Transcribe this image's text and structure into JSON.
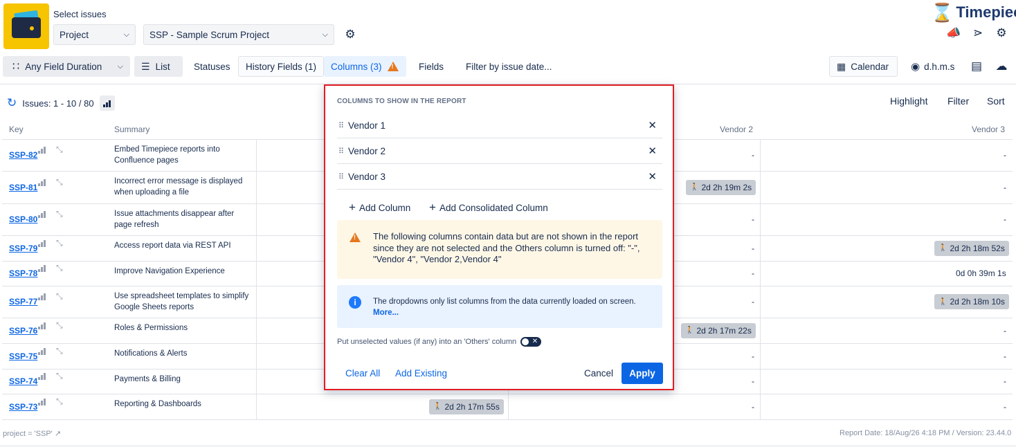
{
  "header": {
    "select_label": "Select issues",
    "scope_select": "Project",
    "project_select": "SSP - Sample Scrum Project",
    "brand": "Timepiece"
  },
  "toolbar": {
    "duration_select": "Any Field Duration",
    "list": "List",
    "statuses": "Statuses",
    "history_fields": "History Fields (1)",
    "columns": "Columns (3)",
    "fields": "Fields",
    "filter_date": "Filter by issue date...",
    "calendar": "Calendar",
    "time_format": "d.h.m.s"
  },
  "issues_bar": {
    "count": "Issues: 1 - 10 / 80",
    "highlight": "Highlight",
    "filter": "Filter",
    "sort": "Sort"
  },
  "table": {
    "headers": {
      "key": "Key",
      "summary": "Summary",
      "vendor2": "Vendor 2",
      "vendor3": "Vendor 3"
    },
    "rows": [
      {
        "key": "SSP-82",
        "summary": "Embed Timepiece reports into Confluence pages",
        "v1": "",
        "v2": "-",
        "v3": "-"
      },
      {
        "key": "SSP-81",
        "summary": "Incorrect error message is displayed when uploading a file",
        "v1": "",
        "v2": "2d 2h 19m 2s",
        "v3": "-"
      },
      {
        "key": "SSP-80",
        "summary": "Issue attachments disappear after page refresh",
        "v1": "",
        "v2": "-",
        "v3": "-"
      },
      {
        "key": "SSP-79",
        "summary": "Access report data via REST API",
        "v1": "",
        "v2": "-",
        "v3": "2d 2h 18m 52s"
      },
      {
        "key": "SSP-78",
        "summary": "Improve Navigation Experience",
        "v1": "",
        "v2": "-",
        "v3": "0d 0h 39m 1s"
      },
      {
        "key": "SSP-77",
        "summary": "Use spreadsheet templates to simplify Google Sheets reports",
        "v1": "",
        "v2": "-",
        "v3": "2d 2h 18m 10s"
      },
      {
        "key": "SSP-76",
        "summary": "Roles & Permissions",
        "v1": "",
        "v2": "2d 2h 17m 22s",
        "v3": "-"
      },
      {
        "key": "SSP-75",
        "summary": "Notifications & Alerts",
        "v1": "",
        "v2": "-",
        "v3": "-"
      },
      {
        "key": "SSP-74",
        "summary": "Payments & Billing",
        "v1": "",
        "v2": "-",
        "v3": "-"
      },
      {
        "key": "SSP-73",
        "summary": "Reporting & Dashboards",
        "v1": "2d 2h 17m 55s",
        "v2": "-",
        "v3": "-"
      }
    ]
  },
  "footer": {
    "jql": "project = 'SSP'",
    "report_info": "Report Date: 18/Aug/26 4:18 PM / Version: 23.44.0"
  },
  "popup": {
    "title": "COLUMNS TO SHOW IN THE REPORT",
    "columns": [
      "Vendor 1",
      "Vendor 2",
      "Vendor 3"
    ],
    "add_column": "Add Column",
    "add_consolidated": "Add Consolidated Column",
    "warning": "The following columns contain data but are not shown in the report since they are not selected and the Others column is turned off: \"-\", \"Vendor 4\", \"Vendor 2,Vendor 4\"",
    "info": "The dropdowns only list columns from the data currently loaded on screen.",
    "info_more": "More...",
    "others_label": "Put unselected values (if any) into an 'Others' column",
    "others_toggle": false,
    "clear_all": "Clear All",
    "add_existing": "Add Existing",
    "cancel": "Cancel",
    "apply": "Apply"
  },
  "colors": {
    "accent": "#0c66e4",
    "highlight_border": "#e31b23",
    "warning": "#e5781d",
    "pill": "#c8ccd3"
  }
}
